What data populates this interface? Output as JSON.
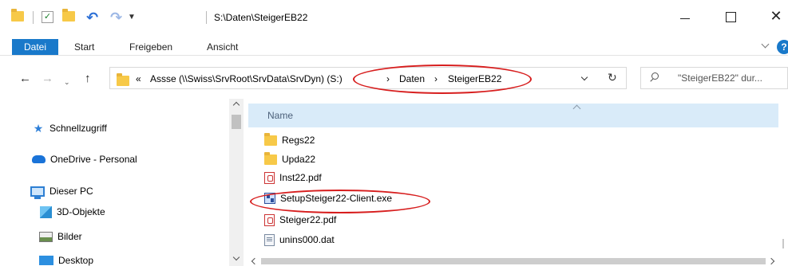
{
  "window": {
    "title": "S:\\Daten\\SteigerEB22",
    "quick_access": [
      "folder-icon",
      "properties-icon",
      "new-folder-icon",
      "undo-icon",
      "redo-icon",
      "customize-arrow"
    ],
    "controls": {
      "close": "✕"
    }
  },
  "ribbon": {
    "tabs": [
      "Datei",
      "Start",
      "Freigeben",
      "Ansicht"
    ],
    "help": "?"
  },
  "navigation": {
    "back": "←",
    "forward": "→",
    "recent": "⌄",
    "up": "↑",
    "breadcrumb": [
      {
        "label": "«"
      },
      {
        "label": "Assse (\\\\Swiss\\SrvRoot\\SrvData\\SrvDyn) (S:)"
      },
      {
        "label": "›"
      },
      {
        "label": "Daten"
      },
      {
        "label": "›"
      },
      {
        "label": "SteigerEB22"
      }
    ],
    "refresh": "↻",
    "search_placeholder": "\"SteigerEB22\" dur..."
  },
  "nav_pane": {
    "items": [
      {
        "label": "Schnellzugriff",
        "icon": "star-icon"
      },
      {
        "label": "OneDrive - Personal",
        "icon": "cloud-icon"
      },
      {
        "label": "Dieser PC",
        "icon": "pc-icon"
      },
      {
        "label": "3D-Objekte",
        "icon": "cube-icon"
      },
      {
        "label": "Bilder",
        "icon": "pictures-icon"
      },
      {
        "label": "Desktop",
        "icon": "desktop-icon"
      }
    ]
  },
  "file_list": {
    "column_header": "Name",
    "files": [
      {
        "name": "Regs22",
        "type": "folder"
      },
      {
        "name": "Upda22",
        "type": "folder"
      },
      {
        "name": "Inst22.pdf",
        "type": "pdf"
      },
      {
        "name": "SetupSteiger22-Client.exe",
        "type": "exe"
      },
      {
        "name": "Steiger22.pdf",
        "type": "pdf"
      },
      {
        "name": "unins000.dat",
        "type": "dat"
      }
    ]
  },
  "annotations": {
    "highlight_color": "#d71e1e",
    "circled": [
      "(S:) › Daten › SteigerEB22",
      "SetupSteiger22-Client.exe"
    ]
  },
  "colors": {
    "accent": "#1979ca",
    "header_bg": "#d9ebf9",
    "folder": "#f7c948"
  }
}
